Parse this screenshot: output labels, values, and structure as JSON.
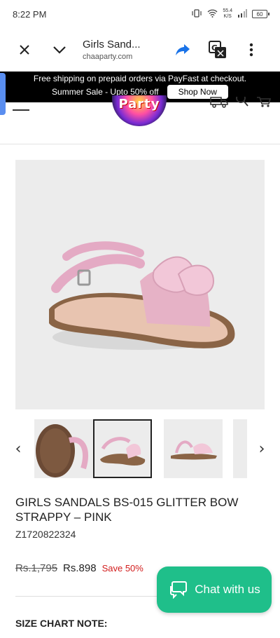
{
  "status": {
    "time": "8:22 PM",
    "net_speed_top": "55.4",
    "net_speed_bottom": "K/S",
    "battery": "60"
  },
  "browser": {
    "title": "Girls Sand...",
    "host": "chaaparty.com"
  },
  "banner": {
    "line1": "Free shipping on prepaid orders via PayFast at checkout.",
    "sale_text": "Summer Sale - Upto 50% off",
    "shop_now": "Shop Now"
  },
  "header": {
    "logo_text": "Party"
  },
  "gallery": {
    "prev": "‹",
    "next": "›"
  },
  "product": {
    "title": "GIRLS SANDALS BS-015 GLITTER BOW STRAPPY – PINK",
    "sku": "Z1720822324",
    "old_price": "Rs.1,795",
    "new_price": "Rs.898",
    "save": "Save 50%",
    "size_chart_label": "SIZE CHART NOTE:"
  },
  "chat": {
    "label": "Chat with us"
  },
  "colors": {
    "chat_green": "#1fbf8a",
    "sale_red": "#d21d1d",
    "banner_black": "#000000"
  }
}
